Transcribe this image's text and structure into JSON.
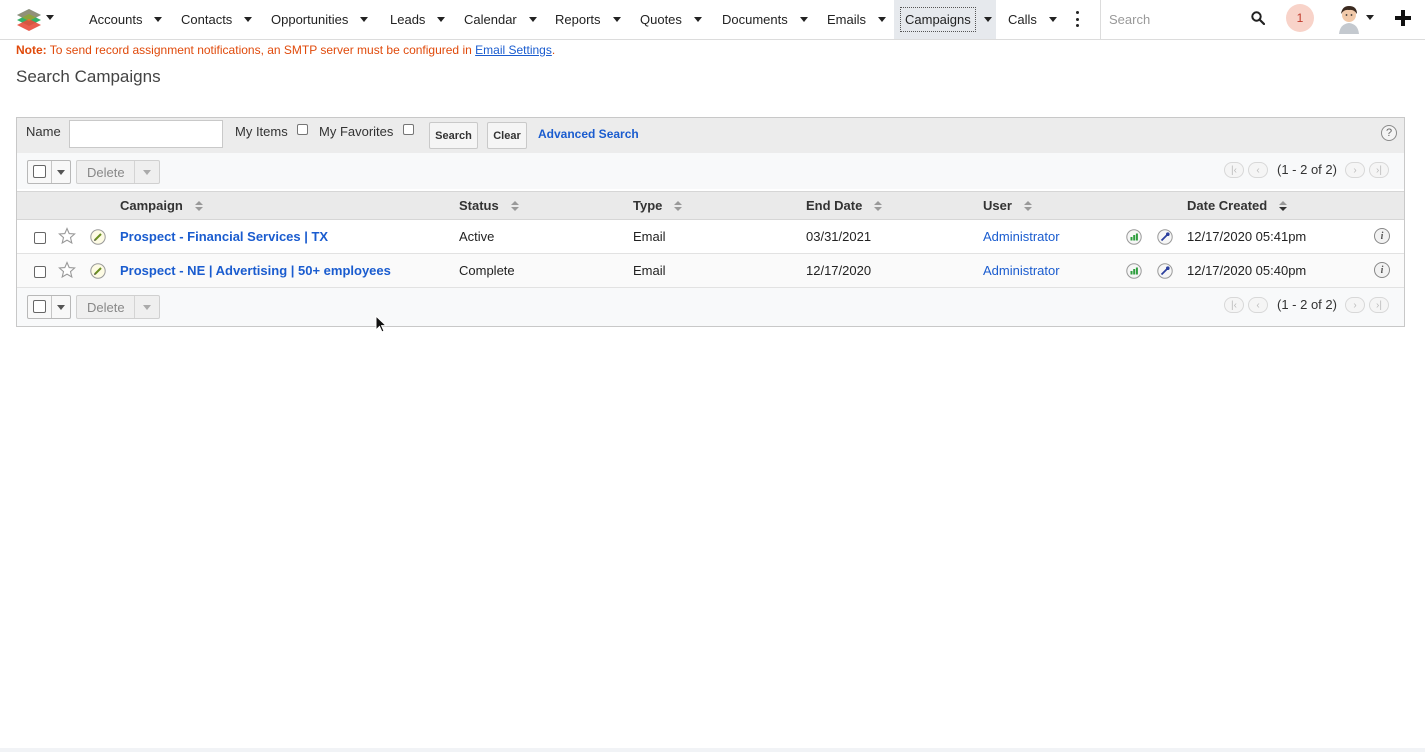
{
  "nav": {
    "logo_icon": "layers-logo-icon",
    "items": [
      {
        "label": "Accounts"
      },
      {
        "label": "Contacts"
      },
      {
        "label": "Opportunities"
      },
      {
        "label": "Leads"
      },
      {
        "label": "Calendar"
      },
      {
        "label": "Reports"
      },
      {
        "label": "Quotes"
      },
      {
        "label": "Documents"
      },
      {
        "label": "Emails"
      },
      {
        "label": "Campaigns",
        "active": true
      },
      {
        "label": "Calls"
      }
    ],
    "search_placeholder": "Search",
    "notification_count": "1"
  },
  "note": {
    "prefix": "Note:",
    "text": "To send record assignment notifications, an SMTP server must be configured in",
    "link": "Email Settings",
    "suffix": "."
  },
  "page_title": "Search Campaigns",
  "search": {
    "name_label": "Name",
    "name_value": "",
    "my_items_label": "My Items",
    "my_favorites_label": "My Favorites",
    "search_button": "Search",
    "clear_button": "Clear",
    "advanced_link": "Advanced Search",
    "help": "?"
  },
  "actions": {
    "delete_label": "Delete",
    "pagination": "(1 - 2 of 2)"
  },
  "table": {
    "columns": [
      "Campaign",
      "Status",
      "Type",
      "End Date",
      "User",
      "Date Created"
    ],
    "rows": [
      {
        "campaign": "Prospect - Financial Services | TX",
        "status": "Active",
        "type": "Email",
        "end_date": "03/31/2021",
        "user": "Administrator",
        "date_created": "12/17/2020 05:41pm"
      },
      {
        "campaign": "Prospect - NE | Advertising | 50+ employees",
        "status": "Complete",
        "type": "Email",
        "end_date": "12/17/2020",
        "user": "Administrator",
        "date_created": "12/17/2020 05:40pm"
      }
    ]
  },
  "colors": {
    "link": "#1a5ccf",
    "note": "#e04a0b",
    "active_tab_bg": "#e6e9ed"
  }
}
